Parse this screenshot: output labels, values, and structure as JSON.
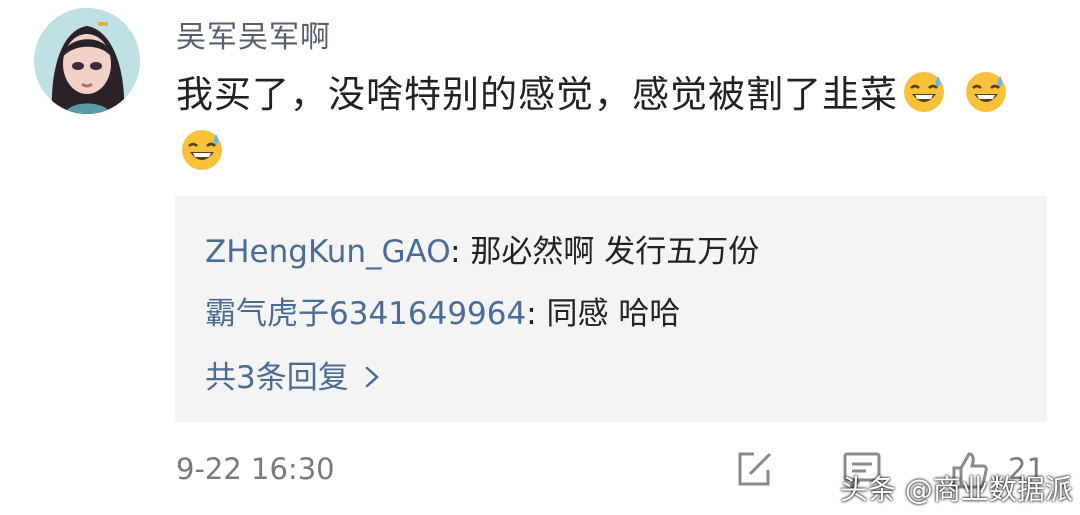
{
  "comment": {
    "username": "吴军吴军啊",
    "text": "我买了，没啥特别的感觉，感觉被割了韭菜",
    "emojis": [
      "sweat-smile-emoji",
      "sweat-smile-emoji",
      "sweat-smile-emoji"
    ],
    "timestamp": "9-22 16:30",
    "like_count": "21"
  },
  "replies": [
    {
      "author": "ZHengKun_GAO",
      "separator": ": ",
      "text": "那必然啊 发行五万份"
    },
    {
      "author": "霸气虎子6341649964",
      "separator": ": ",
      "text": "同感  哈哈"
    }
  ],
  "more_replies_label": "共3条回复",
  "icons": [
    "edit-icon",
    "comment-icon",
    "like-icon",
    "chevron-right-icon"
  ],
  "watermark": "头条 @商业数据派",
  "colors": {
    "link_blue": "#4a6c95",
    "reply_bg": "#f4f4f4",
    "muted": "#7a7a7a"
  }
}
